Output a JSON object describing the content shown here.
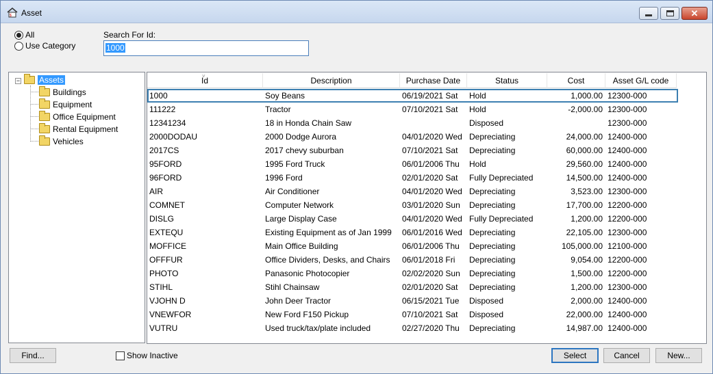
{
  "window": {
    "title": "Asset",
    "close_glyph": "✕"
  },
  "filter": {
    "all_label": "All",
    "use_category_label": "Use Category",
    "selected": "all"
  },
  "search": {
    "label": "Search For Id:",
    "value": "1000"
  },
  "tree": {
    "root": {
      "expander": "−",
      "label": "Assets"
    },
    "children": [
      {
        "label": "Buildings"
      },
      {
        "label": "Equipment"
      },
      {
        "label": "Office Equipment"
      },
      {
        "label": "Rental Equipment"
      },
      {
        "label": "Vehicles"
      }
    ]
  },
  "table": {
    "columns": [
      "Id",
      "Description",
      "Purchase Date",
      "Status",
      "Cost",
      "Asset G/L code"
    ],
    "sort_caret": "˅",
    "rows": [
      [
        "1000",
        "Soy Beans",
        "06/19/2021 Sat",
        "Hold",
        "1,000.00",
        "12300-000"
      ],
      [
        "111222",
        "Tractor",
        "07/10/2021 Sat",
        "Hold",
        "-2,000.00",
        "12300-000"
      ],
      [
        "12341234",
        "18 in Honda Chain Saw",
        "",
        "Disposed",
        "",
        "12300-000"
      ],
      [
        "2000DODAU",
        "2000 Dodge Aurora",
        "04/01/2020 Wed",
        "Depreciating",
        "24,000.00",
        "12400-000"
      ],
      [
        "2017CS",
        "2017 chevy suburban",
        "07/10/2021 Sat",
        "Depreciating",
        "60,000.00",
        "12400-000"
      ],
      [
        "95FORD",
        "1995 Ford Truck",
        "06/01/2006 Thu",
        "Hold",
        "29,560.00",
        "12400-000"
      ],
      [
        "96FORD",
        "1996 Ford",
        "02/01/2020 Sat",
        "Fully Depreciated",
        "14,500.00",
        "12400-000"
      ],
      [
        "AIR",
        "Air Conditioner",
        "04/01/2020 Wed",
        "Depreciating",
        "3,523.00",
        "12300-000"
      ],
      [
        "COMNET",
        "Computer Network",
        "03/01/2020 Sun",
        "Depreciating",
        "17,700.00",
        "12200-000"
      ],
      [
        "DISLG",
        "Large Display Case",
        "04/01/2020 Wed",
        "Fully Depreciated",
        "1,200.00",
        "12200-000"
      ],
      [
        "EXTEQU",
        "Existing Equipment as of Jan 1999",
        "06/01/2016 Wed",
        "Depreciating",
        "22,105.00",
        "12300-000"
      ],
      [
        "MOFFICE",
        "Main Office Building",
        "06/01/2006 Thu",
        "Depreciating",
        "105,000.00",
        "12100-000"
      ],
      [
        "OFFFUR",
        "Office Dividers, Desks, and Chairs",
        "06/01/2018 Fri",
        "Depreciating",
        "9,054.00",
        "12200-000"
      ],
      [
        "PHOTO",
        "Panasonic Photocopier",
        "02/02/2020 Sun",
        "Depreciating",
        "1,500.00",
        "12200-000"
      ],
      [
        "STIHL",
        "Stihl Chainsaw",
        "02/01/2020 Sat",
        "Depreciating",
        "1,200.00",
        "12300-000"
      ],
      [
        "VJOHN D",
        "John Deer Tractor",
        "06/15/2021 Tue",
        "Disposed",
        "2,000.00",
        "12400-000"
      ],
      [
        "VNEWFOR",
        "New Ford F150 Pickup",
        "07/10/2021 Sat",
        "Disposed",
        "22,000.00",
        "12400-000"
      ],
      [
        "VUTRU",
        "Used truck/tax/plate included",
        "02/27/2020 Thu",
        "Depreciating",
        "14,987.00",
        "12400-000"
      ]
    ]
  },
  "footer": {
    "find_label": "Find...",
    "show_inactive_label": "Show Inactive",
    "select_label": "Select",
    "cancel_label": "Cancel",
    "new_label": "New..."
  }
}
